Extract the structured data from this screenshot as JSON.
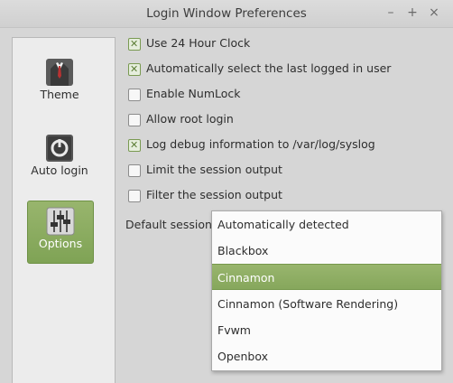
{
  "window": {
    "title": "Login Window Preferences",
    "controls": {
      "minimize": "–",
      "maximize": "+",
      "close": "×"
    }
  },
  "sidebar": {
    "items": [
      {
        "label": "Theme",
        "icon": "tuxedo-icon",
        "active": false
      },
      {
        "label": "Auto login",
        "icon": "power-icon",
        "active": false
      },
      {
        "label": "Options",
        "icon": "sliders-icon",
        "active": true
      }
    ]
  },
  "options": [
    {
      "label": "Use 24 Hour Clock",
      "checked": true
    },
    {
      "label": "Automatically select the last logged in user",
      "checked": true
    },
    {
      "label": "Enable NumLock",
      "checked": false
    },
    {
      "label": "Allow root login",
      "checked": false
    },
    {
      "label": "Log debug information to /var/log/syslog",
      "checked": true
    },
    {
      "label": "Limit the session output",
      "checked": false
    },
    {
      "label": "Filter the session output",
      "checked": false
    }
  ],
  "session": {
    "label": "Default session:",
    "options": [
      "Automatically detected",
      "Blackbox",
      "Cinnamon",
      "Cinnamon (Software Rendering)",
      "Fvwm",
      "Openbox"
    ],
    "selected": "Cinnamon"
  },
  "colors": {
    "accent": "#8bae5f",
    "window_bg": "#d6d6d6",
    "sidebar_bg": "#ececec"
  }
}
